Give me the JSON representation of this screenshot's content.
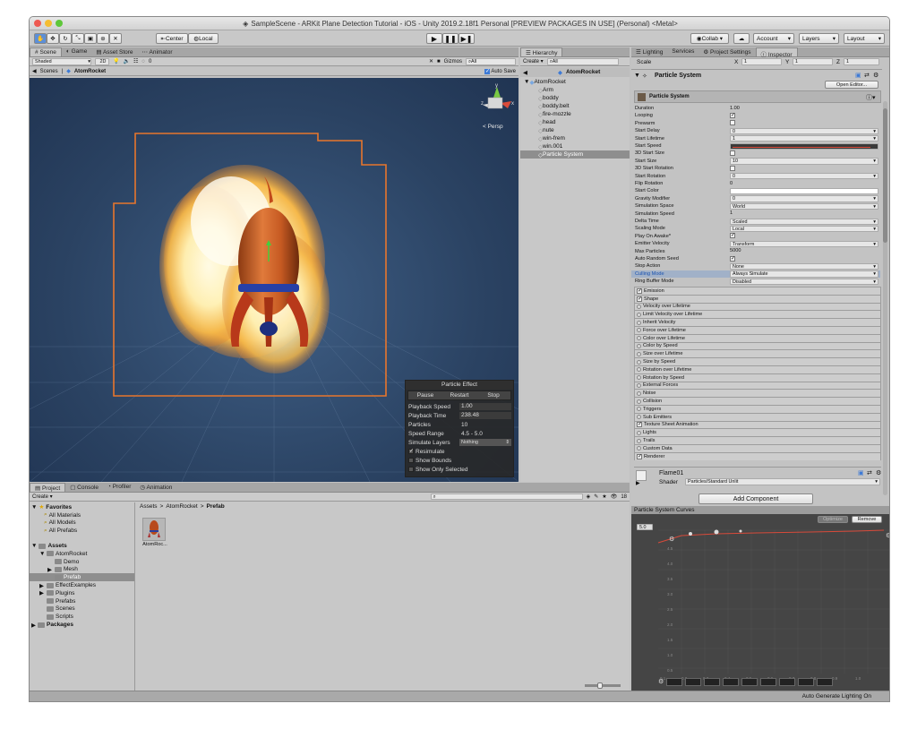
{
  "window": {
    "title": "SampleScene - ARKit Plane Detection Tutorial - iOS - Unity 2019.2.18f1 Personal [PREVIEW PACKAGES IN USE] (Personal) <Metal>"
  },
  "toolbar": {
    "tools": [
      "hand-tool",
      "move-tool",
      "rotate-tool",
      "scale-tool",
      "rect-tool",
      "transform-tool",
      "custom-tool"
    ],
    "pivot_label": "Center",
    "space_label": "Local",
    "collab_label": "Collab ▾",
    "account_label": "Account",
    "layers_label": "Layers",
    "layout_label": "Layout"
  },
  "scene_panel": {
    "tabs": [
      "Scene",
      "Game",
      "Asset Store",
      "Animator"
    ],
    "shading_mode": "Shaded",
    "mode_2d": "2D",
    "gizmos_label": "Gizmos",
    "search_placeholder": "All",
    "fx_count": "0",
    "breadcrumb_root": "Scenes",
    "breadcrumb_item": "AtomRocket",
    "auto_save_label": "Auto Save",
    "persp_label": "< Persp",
    "gizmo_axes": {
      "y": "y",
      "x": "x",
      "z": "z"
    }
  },
  "particle_effect": {
    "title": "Particle Effect",
    "buttons": [
      "Pause",
      "Restart",
      "Stop"
    ],
    "rows": [
      {
        "label": "Playback Speed",
        "value": "1.00"
      },
      {
        "label": "Playback Time",
        "value": "238.48"
      },
      {
        "label": "Particles",
        "value": "10"
      },
      {
        "label": "Speed Range",
        "value": "4.5 - 5.0"
      },
      {
        "label": "Simulate Layers",
        "value": "Nothing"
      }
    ],
    "toggles": [
      {
        "label": "Resimulate",
        "checked": true
      },
      {
        "label": "Show Bounds",
        "checked": false
      },
      {
        "label": "Show Only Selected",
        "checked": false
      }
    ]
  },
  "hierarchy": {
    "tab": "Hierarchy",
    "create_label": "Create ▾",
    "search_placeholder": "All",
    "scene_root": "AtomRocket",
    "root": "AtomRocket",
    "items": [
      "Arm",
      "boddy",
      "boddy.belt",
      "fire-mozzle",
      "head",
      "nute",
      "win-frem",
      "win.001",
      "Particle System"
    ],
    "selected": "Particle System"
  },
  "inspector": {
    "tabs": [
      "Lighting",
      "Services",
      "Project Settings",
      "Inspector"
    ],
    "scale_label": "Scale",
    "scale": {
      "x_label": "X",
      "x": "1",
      "y_label": "Y",
      "y": "1",
      "z_label": "Z",
      "z": "1"
    },
    "component_title": "Particle System",
    "open_editor_label": "Open Editor...",
    "module_title": "Particle System",
    "properties": [
      {
        "label": "Duration",
        "value": "1.00",
        "kind": "plain"
      },
      {
        "label": "Looping",
        "value": "✓",
        "kind": "check"
      },
      {
        "label": "Prewarm",
        "value": "",
        "kind": "check"
      },
      {
        "label": "Start Delay",
        "value": "0",
        "kind": "field"
      },
      {
        "label": "Start Lifetime",
        "value": "1",
        "kind": "field"
      },
      {
        "label": "Start Speed",
        "value": "",
        "kind": "curve"
      },
      {
        "label": "3D Start Size",
        "value": "",
        "kind": "check"
      },
      {
        "label": "Start Size",
        "value": "10",
        "kind": "field"
      },
      {
        "label": "3D Start Rotation",
        "value": "",
        "kind": "check"
      },
      {
        "label": "Start Rotation",
        "value": "0",
        "kind": "field"
      },
      {
        "label": "Flip Rotation",
        "value": "0",
        "kind": "plain"
      },
      {
        "label": "Start Color",
        "value": "",
        "kind": "color"
      },
      {
        "label": "Gravity Modifier",
        "value": "0",
        "kind": "field"
      },
      {
        "label": "Simulation Space",
        "value": "World",
        "kind": "field"
      },
      {
        "label": "Simulation Speed",
        "value": "1",
        "kind": "plain"
      },
      {
        "label": "Delta Time",
        "value": "Scaled",
        "kind": "field"
      },
      {
        "label": "Scaling Mode",
        "value": "Local",
        "kind": "field"
      },
      {
        "label": "Play On Awake*",
        "value": "✓",
        "kind": "check"
      },
      {
        "label": "Emitter Velocity",
        "value": "Transform",
        "kind": "field"
      },
      {
        "label": "Max Particles",
        "value": "5000",
        "kind": "plain"
      },
      {
        "label": "Auto Random Seed",
        "value": "✓",
        "kind": "check"
      },
      {
        "label": "Stop Action",
        "value": "None",
        "kind": "field"
      },
      {
        "label": "Culling Mode",
        "value": "Always Simulate",
        "kind": "field"
      },
      {
        "label": "Ring Buffer Mode",
        "value": "Disabled",
        "kind": "field"
      }
    ],
    "modules": [
      {
        "label": "Emission",
        "checked": true
      },
      {
        "label": "Shape",
        "checked": true
      },
      {
        "label": "Velocity over Lifetime",
        "checked": false
      },
      {
        "label": "Limit Velocity over Lifetime",
        "checked": false
      },
      {
        "label": "Inherit Velocity",
        "checked": false
      },
      {
        "label": "Force over Lifetime",
        "checked": false
      },
      {
        "label": "Color over Lifetime",
        "checked": false
      },
      {
        "label": "Color by Speed",
        "checked": false
      },
      {
        "label": "Size over Lifetime",
        "checked": false
      },
      {
        "label": "Size by Speed",
        "checked": false
      },
      {
        "label": "Rotation over Lifetime",
        "checked": false
      },
      {
        "label": "Rotation by Speed",
        "checked": false
      },
      {
        "label": "External Forces",
        "checked": false
      },
      {
        "label": "Noise",
        "checked": false
      },
      {
        "label": "Collision",
        "checked": false
      },
      {
        "label": "Triggers",
        "checked": false
      },
      {
        "label": "Sub Emitters",
        "checked": false
      },
      {
        "label": "Texture Sheet Animation",
        "checked": true
      },
      {
        "label": "Lights",
        "checked": false
      },
      {
        "label": "Trails",
        "checked": false
      },
      {
        "label": "Custom Data",
        "checked": false
      },
      {
        "label": "Renderer",
        "checked": true
      }
    ],
    "material_name": "Flame01",
    "shader_label": "Shader",
    "shader_value": "Particles/Standard Unlit",
    "add_component_label": "Add Component"
  },
  "curves": {
    "title": "Particle System Curves",
    "optimize_label": "Optimize",
    "remove_label": "Remove",
    "max_value": "5.0",
    "y_ticks": [
      "4.5",
      "4.0",
      "3.5",
      "3.0",
      "2.5",
      "2.0",
      "1.5",
      "1.0",
      "0.5"
    ],
    "x_ticks": [
      "0.1",
      "0.2",
      "0.3",
      "0.4",
      "0.5",
      "0.6",
      "0.7",
      "0.8",
      "0.9",
      "1.0"
    ]
  },
  "project": {
    "tabs": [
      "Project",
      "Console",
      "Profiler",
      "Animation"
    ],
    "create_label": "Create ▾",
    "badge_count": "18",
    "favorites_label": "Favorites",
    "favorites": [
      "All Materials",
      "All Models",
      "All Prefabs"
    ],
    "assets_label": "Assets",
    "tree": [
      {
        "label": "AtomRocket",
        "depth": 1,
        "arrow": "▼"
      },
      {
        "label": "Demo",
        "depth": 2,
        "arrow": ""
      },
      {
        "label": "Mesh",
        "depth": 2,
        "arrow": "▶"
      },
      {
        "label": "Prefab",
        "depth": 2,
        "arrow": "",
        "selected": true
      },
      {
        "label": "EffectExamples",
        "depth": 1,
        "arrow": "▶"
      },
      {
        "label": "Plugins",
        "depth": 1,
        "arrow": "▶"
      },
      {
        "label": "Prefabs",
        "depth": 1,
        "arrow": ""
      },
      {
        "label": "Scenes",
        "depth": 1,
        "arrow": ""
      },
      {
        "label": "Scripts",
        "depth": 1,
        "arrow": ""
      }
    ],
    "packages_label": "Packages",
    "breadcrumb": [
      "Assets",
      "AtomRocket",
      "Prefab"
    ],
    "asset_tile": "AtomRoc..."
  },
  "status_bar": {
    "text": "Auto Generate Lighting On"
  },
  "colors": {
    "selection": "#3d7ad6",
    "bounds": "#e8762c",
    "scene_bg": "#2b4363"
  }
}
